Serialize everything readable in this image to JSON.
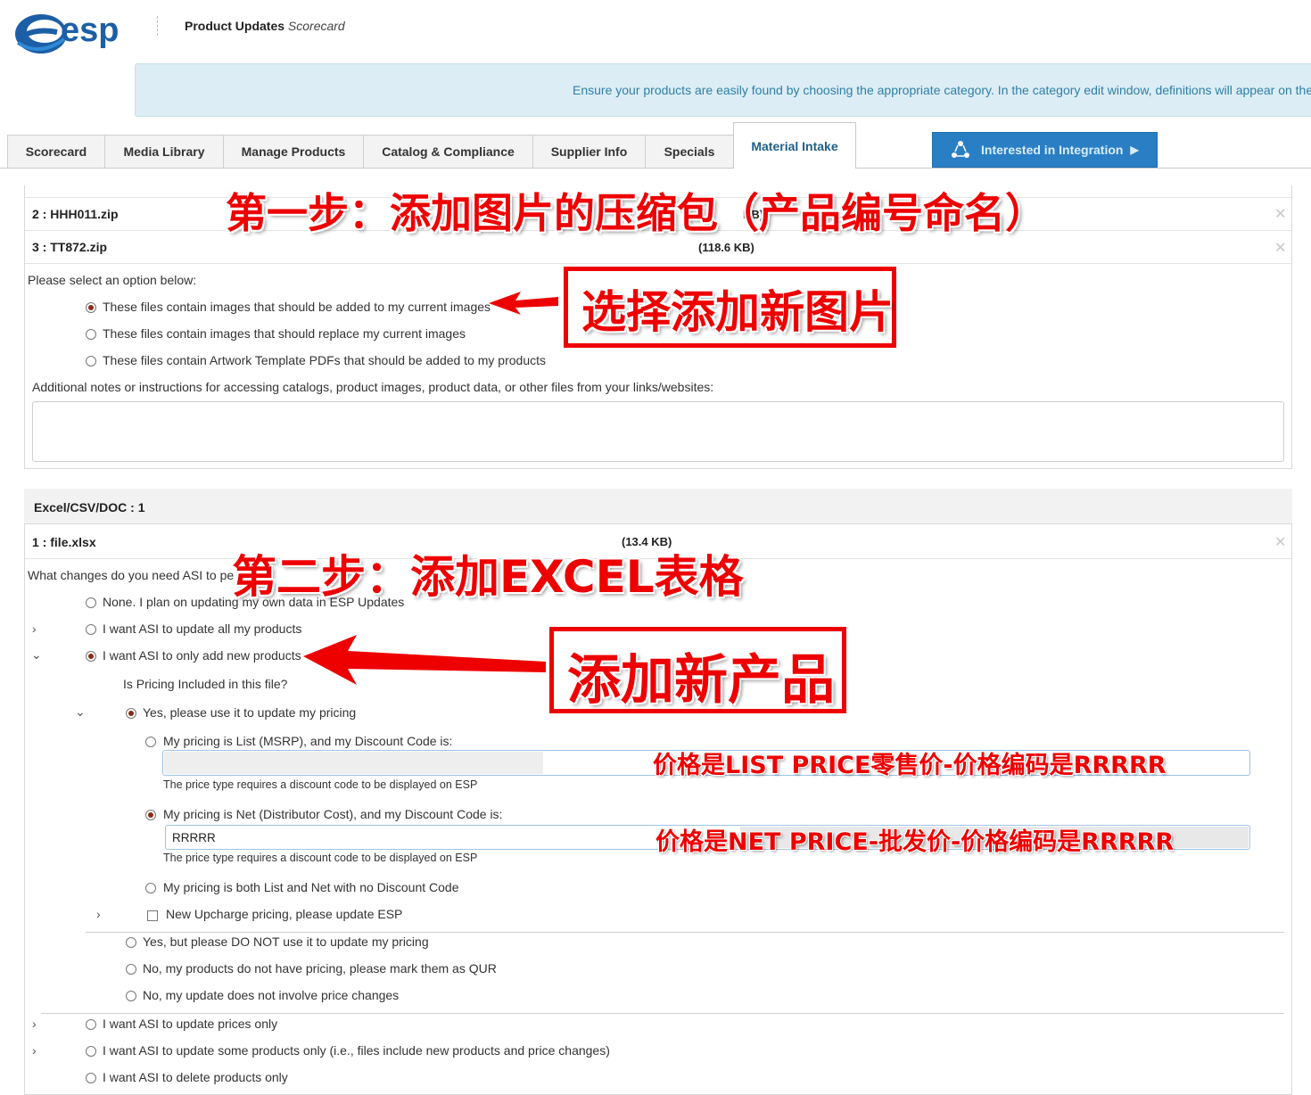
{
  "header": {
    "logo_text": "esp",
    "app_title": "Product Updates",
    "app_subtitle": "Scorecard"
  },
  "banner": {
    "text": "Ensure your products are easily found by choosing the appropriate category. In the category edit window, definitions will appear on the"
  },
  "tabs": [
    {
      "label": "Scorecard"
    },
    {
      "label": "Media Library"
    },
    {
      "label": "Manage Products"
    },
    {
      "label": "Catalog & Compliance"
    },
    {
      "label": "Supplier Info"
    },
    {
      "label": "Specials"
    },
    {
      "label": "Material Intake",
      "active": true
    }
  ],
  "integration_button": {
    "label": "Interested in Integration",
    "color": "#2a7fc4"
  },
  "image_files": [
    {
      "index": "2",
      "name": "HHH011.zip",
      "size": "KB)"
    },
    {
      "index": "3",
      "name": "TT872.zip",
      "size": "(118.6 KB)"
    }
  ],
  "image_options": {
    "prompt": "Please select an option below:",
    "options": [
      {
        "label": "These files contain images that should be added to my current images",
        "selected": true
      },
      {
        "label": "These files contain images that should replace my current images",
        "selected": false
      },
      {
        "label": "These files contain Artwork Template PDFs that should be added to my products",
        "selected": false
      }
    ],
    "notes_label": "Additional notes or instructions for accessing catalogs, product images, product data, or other files from your links/websites:",
    "notes_value": ""
  },
  "excel_section": {
    "header": "Excel/CSV/DOC : 1",
    "file": {
      "index": "1",
      "name": "file.xlsx",
      "size": "(13.4 KB)"
    },
    "question": "What changes do you need ASI to pe",
    "options": [
      {
        "label": "None. I plan on updating my own data in ESP Updates",
        "selected": false
      },
      {
        "label": "I want ASI to update all my products",
        "selected": false
      },
      {
        "label": "I want ASI to only add new products",
        "selected": true
      }
    ],
    "pricing_question": "Is Pricing Included in this file?",
    "pricing_yes": "Yes, please use it to update my pricing",
    "list_option": "My pricing is List (MSRP), and my Discount Code is:",
    "list_value": "",
    "hint": "The price type requires a discount code to be displayed on ESP",
    "net_option": "My pricing is Net (Distributor Cost), and my Discount Code is:",
    "net_value": "RRRRR",
    "both_option": "My pricing is both List and Net with no Discount Code",
    "upcharge": "New Upcharge pricing, please update ESP",
    "pricing_other": [
      "Yes, but please DO NOT use it to update my pricing",
      "No, my products do not have pricing, please mark them as QUR",
      "No, my update does not involve price changes"
    ],
    "more_options": [
      "I want ASI to update prices only",
      "I want ASI to update some products only (i.e., files include new products and price changes)",
      "I want ASI to delete products only"
    ]
  },
  "annotations": {
    "step1": "第一步：添加图片的压缩包（产品编号命名）",
    "select_new_images": "选择添加新图片",
    "step2": "第二步：添加EXCEL表格",
    "add_new_products": "添加新产品",
    "list_price_note": "价格是LIST PRICE零售价-价格编码是RRRRR",
    "net_price_note": "价格是NET PRICE-批发价-价格编码是RRRRR",
    "color": "#ee0000"
  }
}
